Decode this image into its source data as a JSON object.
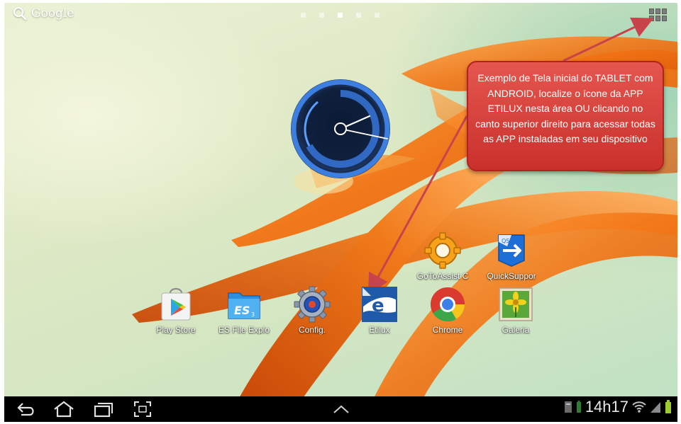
{
  "topbar": {
    "search_label": "Google",
    "page_dots": [
      {
        "active": false
      },
      {
        "active": false
      },
      {
        "active": true
      },
      {
        "active": false
      },
      {
        "active": false
      }
    ]
  },
  "callout": {
    "text": "Exemplo de Tela inicial do TABLET com ANDROID, localize o ícone da APP ETILUX nesta área OU clicando no canto superior direito para acessar todas as APP instaladas em seu dispositivo"
  },
  "apps_row_top": [
    {
      "label": "GoToAssist C",
      "icon": "gotoassist-icon"
    },
    {
      "label": "QuickSuppor",
      "icon": "quicksupport-icon"
    }
  ],
  "apps_row_bottom": [
    {
      "label": "Play Store",
      "icon": "play-store-icon"
    },
    {
      "label": "ES File Explo",
      "icon": "es-file-explorer-icon"
    },
    {
      "label": "Config.",
      "icon": "settings-icon"
    },
    {
      "label": "Etilux",
      "icon": "etilux-icon"
    },
    {
      "label": "Chrome",
      "icon": "chrome-icon"
    },
    {
      "label": "Galeria",
      "icon": "gallery-icon"
    }
  ],
  "status_bar": {
    "time": "14h17"
  },
  "colors": {
    "callout_bg": "#d9433e",
    "petal": "#f07a1a",
    "navbar": "#000000"
  }
}
